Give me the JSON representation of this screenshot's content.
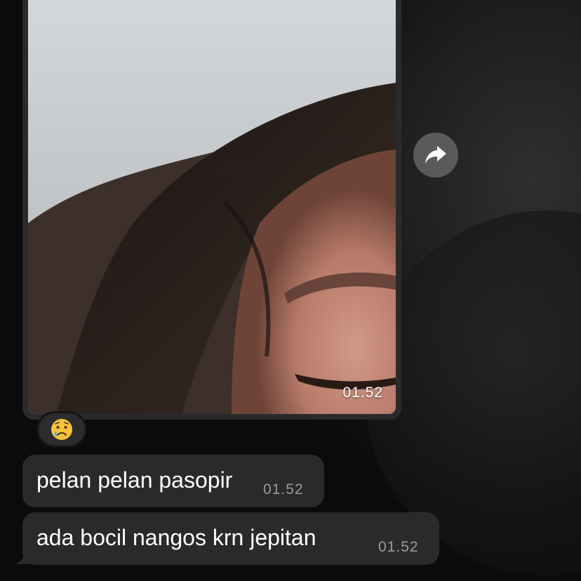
{
  "photo_message": {
    "time": "01.52",
    "forward_icon": "forward-arrow-icon",
    "reaction_icon": "crying-face-icon"
  },
  "messages": [
    {
      "text": "pelan pelan pasopir",
      "time": "01.52"
    },
    {
      "text": "ada bocil nangos krn jepitan",
      "time": "01.52"
    }
  ],
  "colors": {
    "bubble": "#2a2a2c",
    "time_text": "#9c9c9f",
    "forward_button": "#5a5a5c"
  }
}
